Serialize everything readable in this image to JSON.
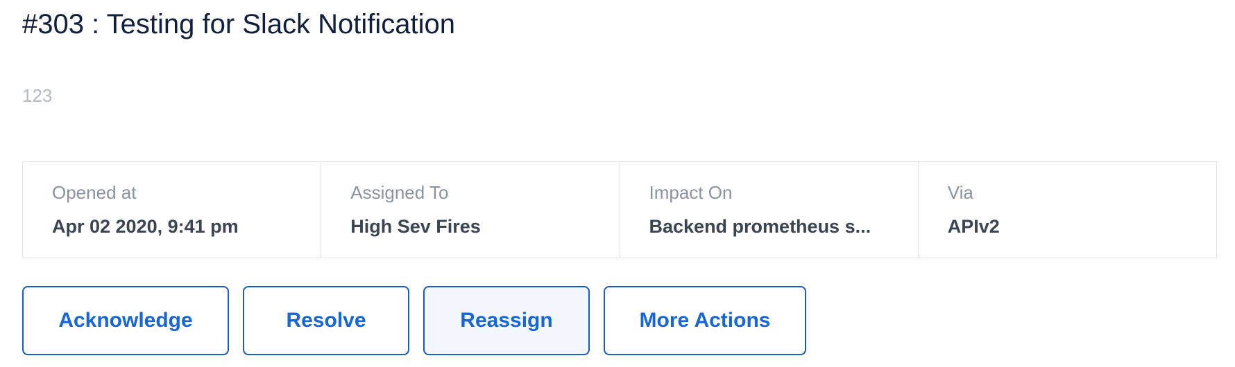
{
  "incident": {
    "title": "#303 : Testing for Slack Notification",
    "description": "123"
  },
  "details": [
    {
      "label": "Opened at",
      "value": "Apr 02 2020, 9:41 pm"
    },
    {
      "label": "Assigned To",
      "value": "High Sev Fires"
    },
    {
      "label": "Impact On",
      "value": "Backend prometheus s..."
    },
    {
      "label": "Via",
      "value": "APIv2"
    }
  ],
  "actions": {
    "acknowledge": "Acknowledge",
    "resolve": "Resolve",
    "reassign": "Reassign",
    "more": "More Actions"
  },
  "colors": {
    "title": "#0f1f3d",
    "accent": "#1766d6",
    "button_border": "#1d5bc2",
    "active_button_bg": "#f2f6fd",
    "muted_text": "#8a93a3",
    "border": "#e2e4e8"
  }
}
